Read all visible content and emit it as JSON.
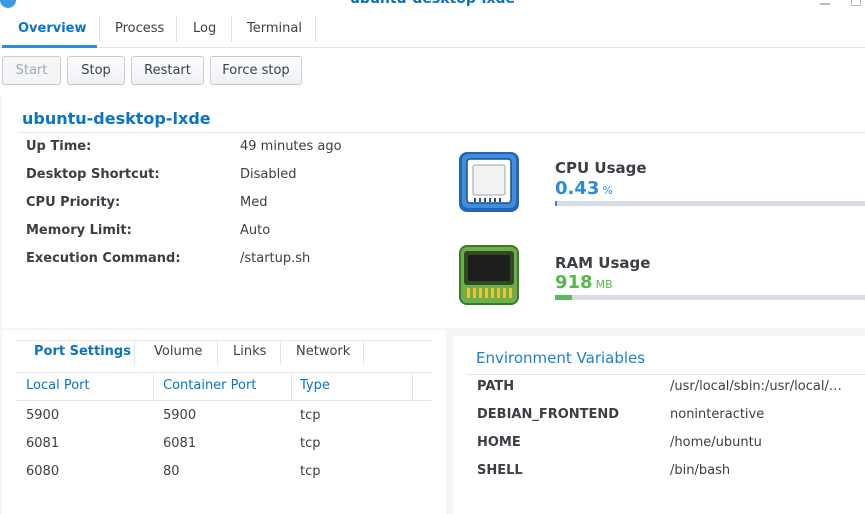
{
  "window": {
    "title": "ubuntu-desktop-lxde"
  },
  "tabs": [
    {
      "label": "Overview",
      "active": true
    },
    {
      "label": "Process",
      "active": false
    },
    {
      "label": "Log",
      "active": false
    },
    {
      "label": "Terminal",
      "active": false
    }
  ],
  "toolbar": {
    "start_label": "Start",
    "stop_label": "Stop",
    "restart_label": "Restart",
    "force_stop_label": "Force stop"
  },
  "overview": {
    "name": "ubuntu-desktop-lxde",
    "fields": [
      {
        "label": "Up Time:",
        "value": "49 minutes ago"
      },
      {
        "label": "Desktop Shortcut:",
        "value": "Disabled"
      },
      {
        "label": "CPU Priority:",
        "value": "Med"
      },
      {
        "label": "Memory Limit:",
        "value": "Auto"
      },
      {
        "label": "Execution Command:",
        "value": "/startup.sh"
      }
    ],
    "cpu": {
      "title": "CPU Usage",
      "value": "0.43",
      "unit": "%",
      "fraction": 0.0043,
      "color": "#2a8ae0"
    },
    "ram": {
      "title": "RAM Usage",
      "value": "918",
      "unit": "MB",
      "fraction": 0.055,
      "color": "#5cb85c"
    }
  },
  "ports": {
    "tabs": [
      {
        "label": "Port Settings",
        "active": true
      },
      {
        "label": "Volume",
        "active": false
      },
      {
        "label": "Links",
        "active": false
      },
      {
        "label": "Network",
        "active": false
      }
    ],
    "columns": [
      "Local Port",
      "Container Port",
      "Type"
    ],
    "rows": [
      [
        "5900",
        "5900",
        "tcp"
      ],
      [
        "6081",
        "6081",
        "tcp"
      ],
      [
        "6080",
        "80",
        "tcp"
      ]
    ]
  },
  "env": {
    "title": "Environment Variables",
    "vars": [
      {
        "key": "PATH",
        "value": "/usr/local/sbin:/usr/local/bin:/usr/sbin:/usr/bin:/sbin:/bin"
      },
      {
        "key": "DEBIAN_FRONTEND",
        "value": "noninteractive"
      },
      {
        "key": "HOME",
        "value": "/home/ubuntu"
      },
      {
        "key": "SHELL",
        "value": "/bin/bash"
      }
    ]
  }
}
